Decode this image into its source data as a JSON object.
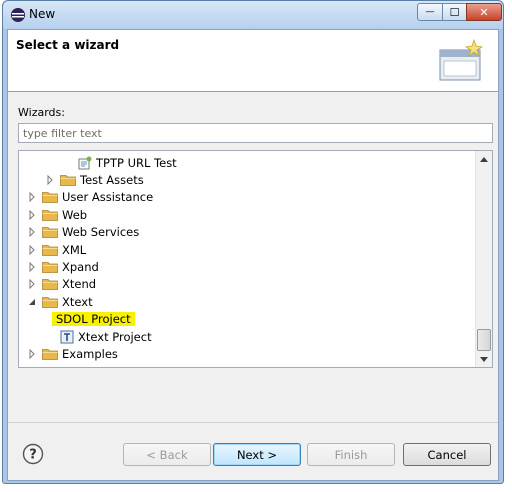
{
  "window": {
    "title": "New",
    "min_symbol": "—",
    "max_symbol": "☐",
    "close_symbol": "✕"
  },
  "header": {
    "title": "Select a wizard"
  },
  "wizards": {
    "label": "Wizards:",
    "filter_placeholder": "type filter text"
  },
  "tree": {
    "items": [
      {
        "label": "TPTP URL Test",
        "kind": "file",
        "depth": 2,
        "expander": "none"
      },
      {
        "label": "Test Assets",
        "kind": "folder",
        "depth": 1,
        "expander": "collapsed"
      },
      {
        "label": "User Assistance",
        "kind": "folder",
        "depth": 0,
        "expander": "collapsed"
      },
      {
        "label": "Web",
        "kind": "folder",
        "depth": 0,
        "expander": "collapsed"
      },
      {
        "label": "Web Services",
        "kind": "folder",
        "depth": 0,
        "expander": "collapsed"
      },
      {
        "label": "XML",
        "kind": "folder",
        "depth": 0,
        "expander": "collapsed"
      },
      {
        "label": "Xpand",
        "kind": "folder",
        "depth": 0,
        "expander": "collapsed"
      },
      {
        "label": "Xtend",
        "kind": "folder",
        "depth": 0,
        "expander": "collapsed"
      },
      {
        "label": "Xtext",
        "kind": "folder",
        "depth": 0,
        "expander": "expanded"
      },
      {
        "label": "SDOL Project",
        "kind": "highlighted",
        "depth": 1,
        "expander": "none"
      },
      {
        "label": "Xtext Project",
        "kind": "xtext",
        "depth": 1,
        "expander": "none"
      },
      {
        "label": "Examples",
        "kind": "folder",
        "depth": 0,
        "expander": "collapsed"
      }
    ]
  },
  "footer": {
    "help_symbol": "?",
    "back_label": "< Back",
    "next_label": "Next >",
    "finish_label": "Finish",
    "cancel_label": "Cancel"
  },
  "colors": {
    "highlight": "#f8f200",
    "folder": "#e8b94a"
  }
}
